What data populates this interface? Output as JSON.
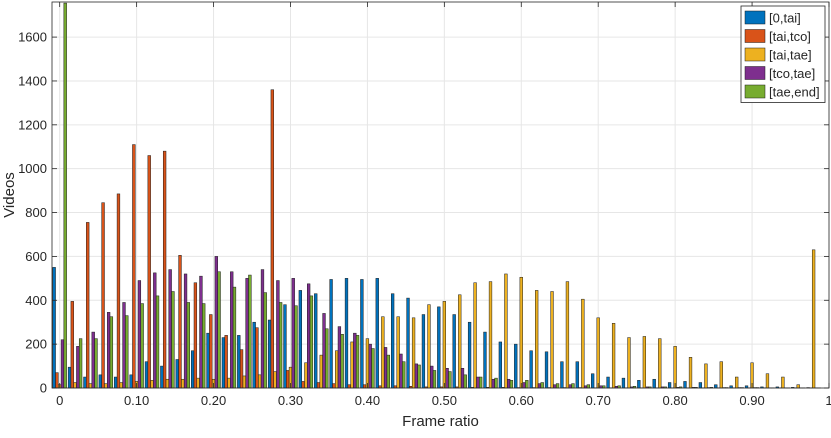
{
  "chart_data": {
    "type": "bar",
    "xlabel": "Frame ratio",
    "ylabel": "Videos",
    "xlim": [
      -0.01,
      1.0
    ],
    "ylim": [
      0,
      1760
    ],
    "grid": true,
    "legend_position": "top-right",
    "x_ticks": [
      0,
      0.1,
      0.2,
      0.3,
      0.4,
      0.5,
      0.6,
      0.7,
      0.8,
      0.9,
      1.0
    ],
    "x_tick_labels": [
      "0",
      "0.10",
      "0.20",
      "0.30",
      "0.40",
      "0.50",
      "0.60",
      "0.70",
      "0.80",
      "0.90",
      "1"
    ],
    "y_ticks": [
      0,
      200,
      400,
      600,
      800,
      1000,
      1200,
      1400,
      1600
    ],
    "y_tick_labels": [
      "0",
      "200",
      "400",
      "600",
      "800",
      "1000",
      "1200",
      "1400",
      "1600"
    ],
    "x": [
      0.0,
      0.02,
      0.04,
      0.06,
      0.08,
      0.1,
      0.12,
      0.14,
      0.16,
      0.18,
      0.2,
      0.22,
      0.24,
      0.26,
      0.28,
      0.3,
      0.32,
      0.34,
      0.36,
      0.38,
      0.4,
      0.42,
      0.44,
      0.46,
      0.48,
      0.5,
      0.52,
      0.54,
      0.56,
      0.58,
      0.6,
      0.62,
      0.64,
      0.66,
      0.68,
      0.7,
      0.72,
      0.74,
      0.76,
      0.78,
      0.8,
      0.82,
      0.84,
      0.86,
      0.88,
      0.9,
      0.92,
      0.94,
      0.96,
      0.98
    ],
    "series": [
      {
        "name": "[0,tai]",
        "color": "#0072BD",
        "values": [
          550,
          95,
          50,
          60,
          50,
          60,
          120,
          100,
          130,
          170,
          250,
          230,
          240,
          300,
          310,
          380,
          445,
          430,
          495,
          500,
          495,
          500,
          430,
          410,
          335,
          370,
          335,
          300,
          255,
          210,
          200,
          170,
          165,
          120,
          120,
          65,
          50,
          45,
          35,
          40,
          25,
          30,
          25,
          15,
          10,
          10,
          5,
          5,
          3,
          2
        ]
      },
      {
        "name": "[tai,tco]",
        "color": "#D95319",
        "values": [
          70,
          395,
          755,
          845,
          885,
          1110,
          1060,
          1080,
          605,
          480,
          335,
          240,
          175,
          275,
          1360,
          80,
          30,
          25,
          20,
          15,
          15,
          10,
          10,
          8,
          5,
          5,
          5,
          3,
          3,
          3,
          2,
          2,
          2,
          2,
          2,
          1,
          1,
          1,
          1,
          1,
          1,
          1,
          1,
          1,
          1,
          1,
          1,
          1,
          1,
          1
        ]
      },
      {
        "name": "[tai,tae]",
        "color": "#EDB120",
        "values": [
          15,
          25,
          20,
          20,
          25,
          30,
          35,
          40,
          40,
          45,
          40,
          45,
          55,
          60,
          75,
          95,
          115,
          150,
          170,
          210,
          225,
          325,
          325,
          320,
          380,
          395,
          425,
          480,
          485,
          520,
          505,
          445,
          440,
          485,
          405,
          320,
          295,
          230,
          235,
          225,
          190,
          140,
          110,
          120,
          50,
          115,
          65,
          50,
          15,
          630
        ]
      },
      {
        "name": "[tco,tae]",
        "color": "#7E2F8E",
        "values": [
          220,
          190,
          255,
          345,
          390,
          490,
          525,
          540,
          520,
          510,
          600,
          530,
          500,
          540,
          490,
          500,
          475,
          340,
          280,
          250,
          200,
          185,
          155,
          110,
          100,
          90,
          90,
          50,
          40,
          40,
          25,
          20,
          15,
          15,
          10,
          10,
          8,
          5,
          5,
          5,
          3,
          3,
          2,
          2,
          2,
          2,
          1,
          1,
          1,
          1
        ]
      },
      {
        "name": "[tae,end]",
        "color": "#77AC30",
        "values": [
          1755,
          225,
          225,
          325,
          330,
          385,
          420,
          440,
          390,
          385,
          530,
          460,
          515,
          435,
          390,
          375,
          420,
          270,
          245,
          240,
          180,
          150,
          120,
          105,
          80,
          75,
          60,
          50,
          45,
          35,
          35,
          25,
          20,
          20,
          15,
          10,
          10,
          8,
          5,
          5,
          5,
          3,
          3,
          2,
          2,
          2,
          1,
          1,
          1,
          1
        ]
      }
    ]
  }
}
